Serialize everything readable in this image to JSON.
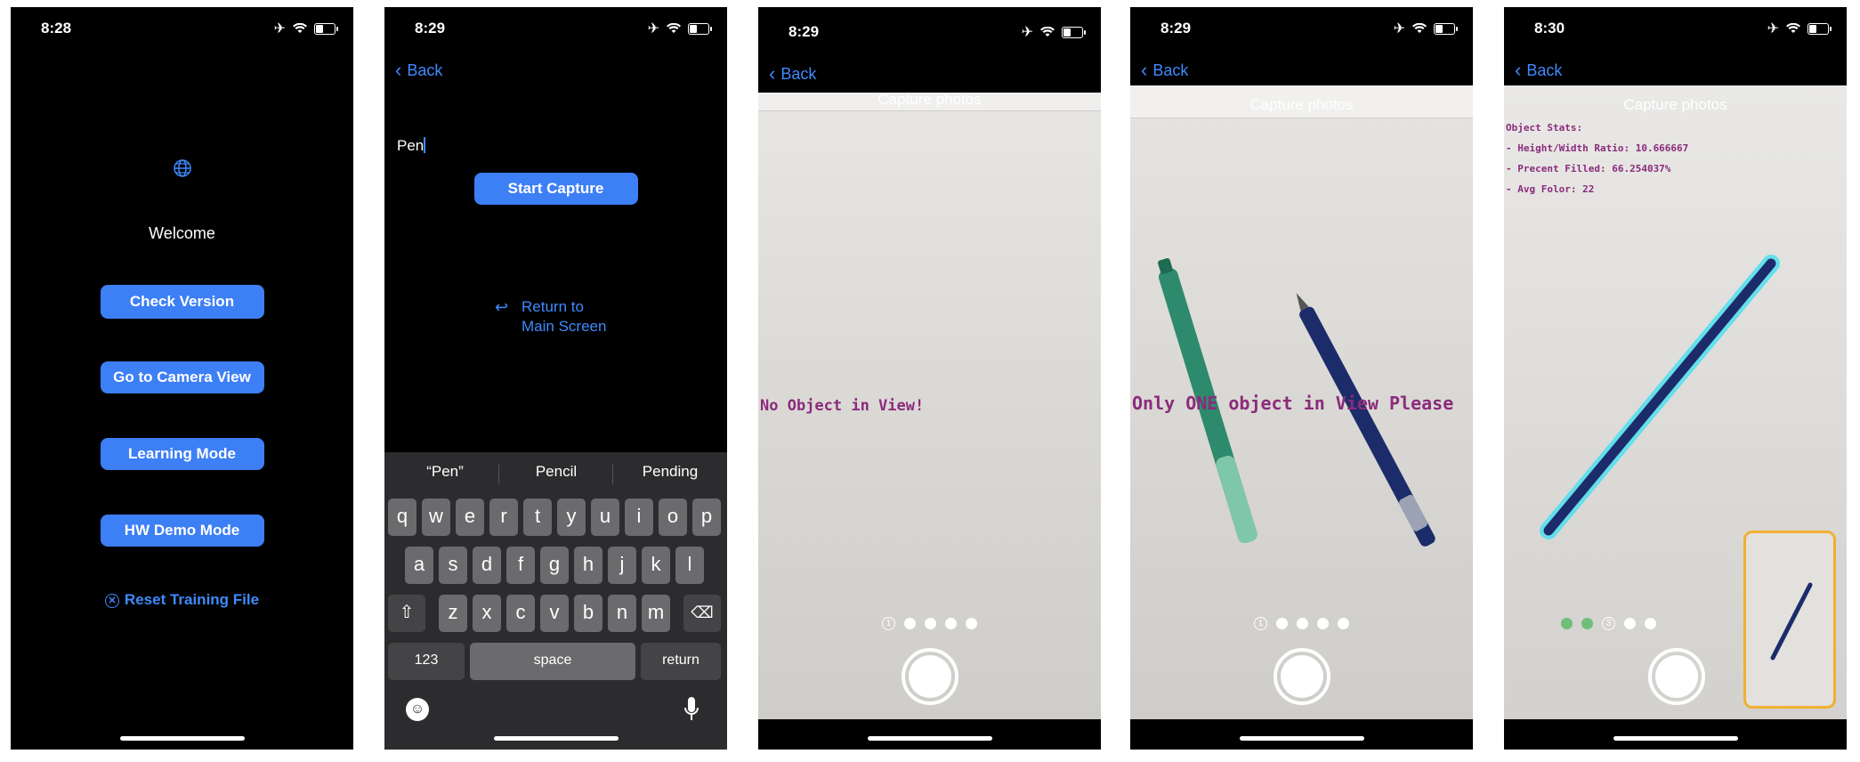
{
  "screens": [
    {
      "time": "8:28",
      "welcome": "Welcome",
      "buttons": [
        "Check Version",
        "Go to Camera View",
        "Learning Mode",
        "HW Demo Mode"
      ],
      "reset_label": "Reset Training File"
    },
    {
      "time": "8:29",
      "back_label": "Back",
      "input_value": "Pen",
      "start_capture_label": "Start Capture",
      "return_line1": "Return to",
      "return_line2": "Main Screen",
      "suggestions": [
        "“Pen”",
        "Pencil",
        "Pending"
      ],
      "row1": [
        "q",
        "w",
        "e",
        "r",
        "t",
        "y",
        "u",
        "i",
        "o",
        "p"
      ],
      "row2": [
        "a",
        "s",
        "d",
        "f",
        "g",
        "h",
        "j",
        "k",
        "l"
      ],
      "row3": [
        "z",
        "x",
        "c",
        "v",
        "b",
        "n",
        "m"
      ],
      "key_123": "123",
      "key_space": "space",
      "key_return": "return"
    },
    {
      "time": "8:29",
      "back_label": "Back",
      "title": "Capture photos",
      "message": "No Object in View!",
      "step": "1"
    },
    {
      "time": "8:29",
      "back_label": "Back",
      "title": "Capture photos",
      "message": "Only ONE object in View Please",
      "step": "1"
    },
    {
      "time": "8:30",
      "back_label": "Back",
      "title": "Capture photos",
      "stats_title": "Object Stats:",
      "stats": [
        "- Height/Width Ratio: 10.666667",
        "- Precent Filled: 66.254037%",
        "- Avg Folor: 22"
      ],
      "step": "3"
    }
  ],
  "colors": {
    "accent": "#3d7ff5",
    "message": "#8a2b7c",
    "thumb_border": "#f0b030",
    "glow": "#4fe0f0"
  }
}
